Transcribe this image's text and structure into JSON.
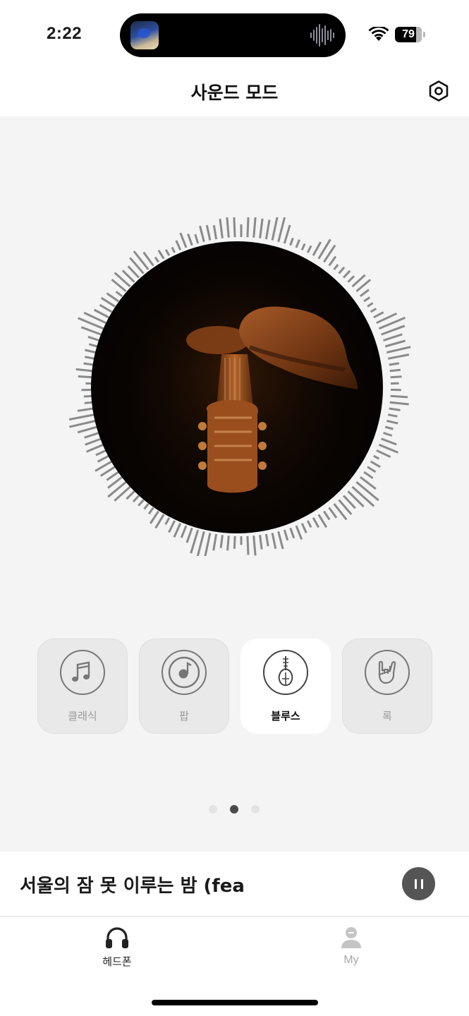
{
  "status_bar": {
    "time": "2:22",
    "battery": "79",
    "icons": [
      "now-playing-thumbnail",
      "audio-waveform-icon",
      "wifi-icon",
      "battery-icon"
    ]
  },
  "header": {
    "title": "사운드 모드",
    "settings_icon": "gear-hexagon-icon"
  },
  "visualizer": {
    "artwork": "guitar-and-cowboy-hat"
  },
  "modes": [
    {
      "label": "클래식",
      "icon": "music-note-icon",
      "active": false
    },
    {
      "label": "팝",
      "icon": "vinyl-record-icon",
      "active": false
    },
    {
      "label": "블루스",
      "icon": "lute-instrument-icon",
      "active": true
    },
    {
      "label": "록",
      "icon": "rock-hand-icon",
      "active": false
    }
  ],
  "pager": {
    "count": 3,
    "active_index": 1
  },
  "mini_player": {
    "title": "서울의 잠 못 이루는 밤 (fea",
    "control_icon": "pause-icon"
  },
  "tabs": [
    {
      "label": "헤드폰",
      "icon": "headphones-icon",
      "active": true
    },
    {
      "label": "My",
      "icon": "person-icon",
      "active": false
    }
  ],
  "colors": {
    "background": "#f4f4f4",
    "active_card": "#ffffff",
    "inactive_card": "#e9e9e9",
    "visualizer_bars": "#8a8a8a",
    "pause_button": "#555555"
  }
}
